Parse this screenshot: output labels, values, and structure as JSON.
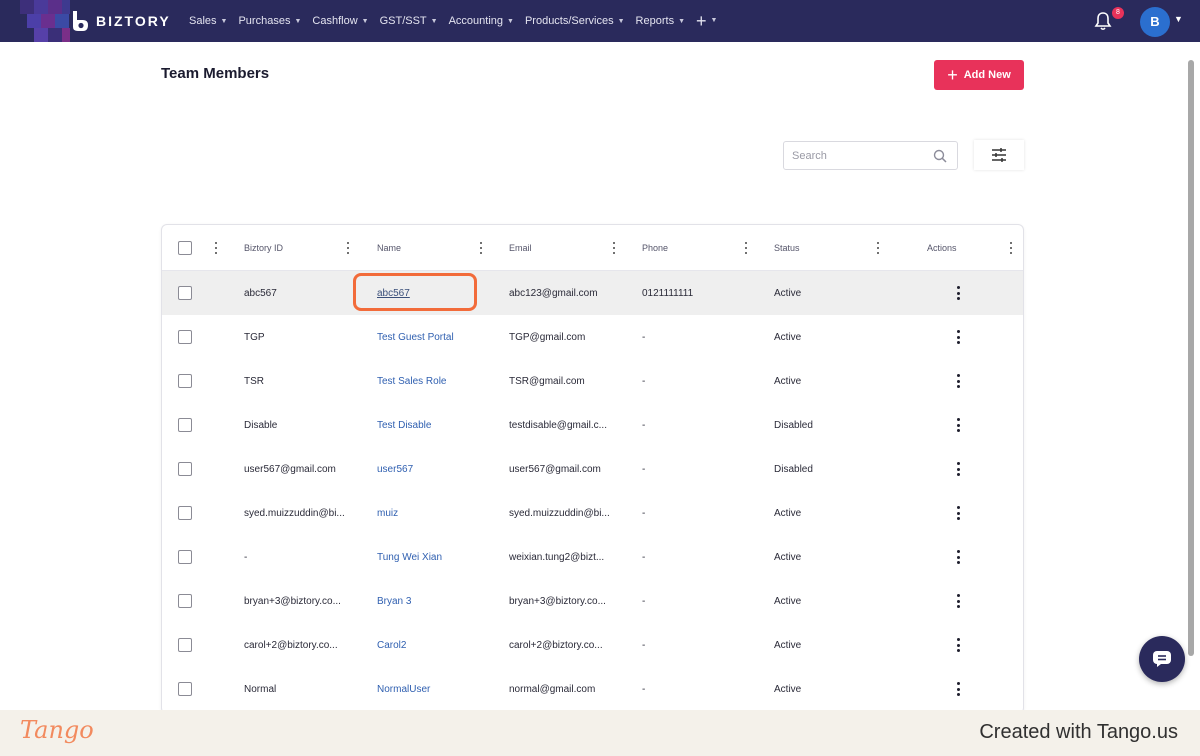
{
  "nav": {
    "brand": "BIZTORY",
    "menu": [
      {
        "label": "Sales"
      },
      {
        "label": "Purchases"
      },
      {
        "label": "Cashflow"
      },
      {
        "label": "GST/SST"
      },
      {
        "label": "Accounting"
      },
      {
        "label": "Products/Services"
      },
      {
        "label": "Reports"
      }
    ],
    "plus_icon": "plus-icon",
    "notification_count": "8",
    "avatar_initial": "B"
  },
  "page": {
    "title": "Team Members",
    "add_button_label": "Add New",
    "search_placeholder": "Search"
  },
  "table": {
    "columns": [
      "Biztory ID",
      "Name",
      "Email",
      "Phone",
      "Status",
      "Actions"
    ],
    "rows": [
      {
        "id": "abc567",
        "name": "abc567",
        "email": "abc123@gmail.com",
        "phone": "0121111111",
        "status": "Active"
      },
      {
        "id": "TGP",
        "name": "Test Guest Portal",
        "email": "TGP@gmail.com",
        "phone": "-",
        "status": "Active"
      },
      {
        "id": "TSR",
        "name": "Test Sales Role",
        "email": "TSR@gmail.com",
        "phone": "-",
        "status": "Active"
      },
      {
        "id": "Disable",
        "name": "Test Disable",
        "email": "testdisable@gmail.c...",
        "phone": "-",
        "status": "Disabled"
      },
      {
        "id": "user567@gmail.com",
        "name": "user567",
        "email": "user567@gmail.com",
        "phone": "-",
        "status": "Disabled"
      },
      {
        "id": "syed.muizzuddin@bi...",
        "name": "muiz",
        "email": "syed.muizzuddin@bi...",
        "phone": "-",
        "status": "Active"
      },
      {
        "id": "-",
        "name": "Tung Wei Xian",
        "email": "weixian.tung2@bizt...",
        "phone": "-",
        "status": "Active"
      },
      {
        "id": "bryan+3@biztory.co...",
        "name": "Bryan 3",
        "email": "bryan+3@biztory.co...",
        "phone": "-",
        "status": "Active"
      },
      {
        "id": "carol+2@biztory.co...",
        "name": "Carol2",
        "email": "carol+2@biztory.co...",
        "phone": "-",
        "status": "Active"
      },
      {
        "id": "Normal",
        "name": "NormalUser",
        "email": "normal@gmail.com",
        "phone": "-",
        "status": "Active"
      }
    ]
  },
  "footer": {
    "logo": "Tango",
    "credit": "Created with Tango.us"
  },
  "colors": {
    "nav_bg": "#2a2a5c",
    "accent": "#e8325a",
    "link": "#2f5fb0",
    "highlight": "#f26b3a"
  }
}
